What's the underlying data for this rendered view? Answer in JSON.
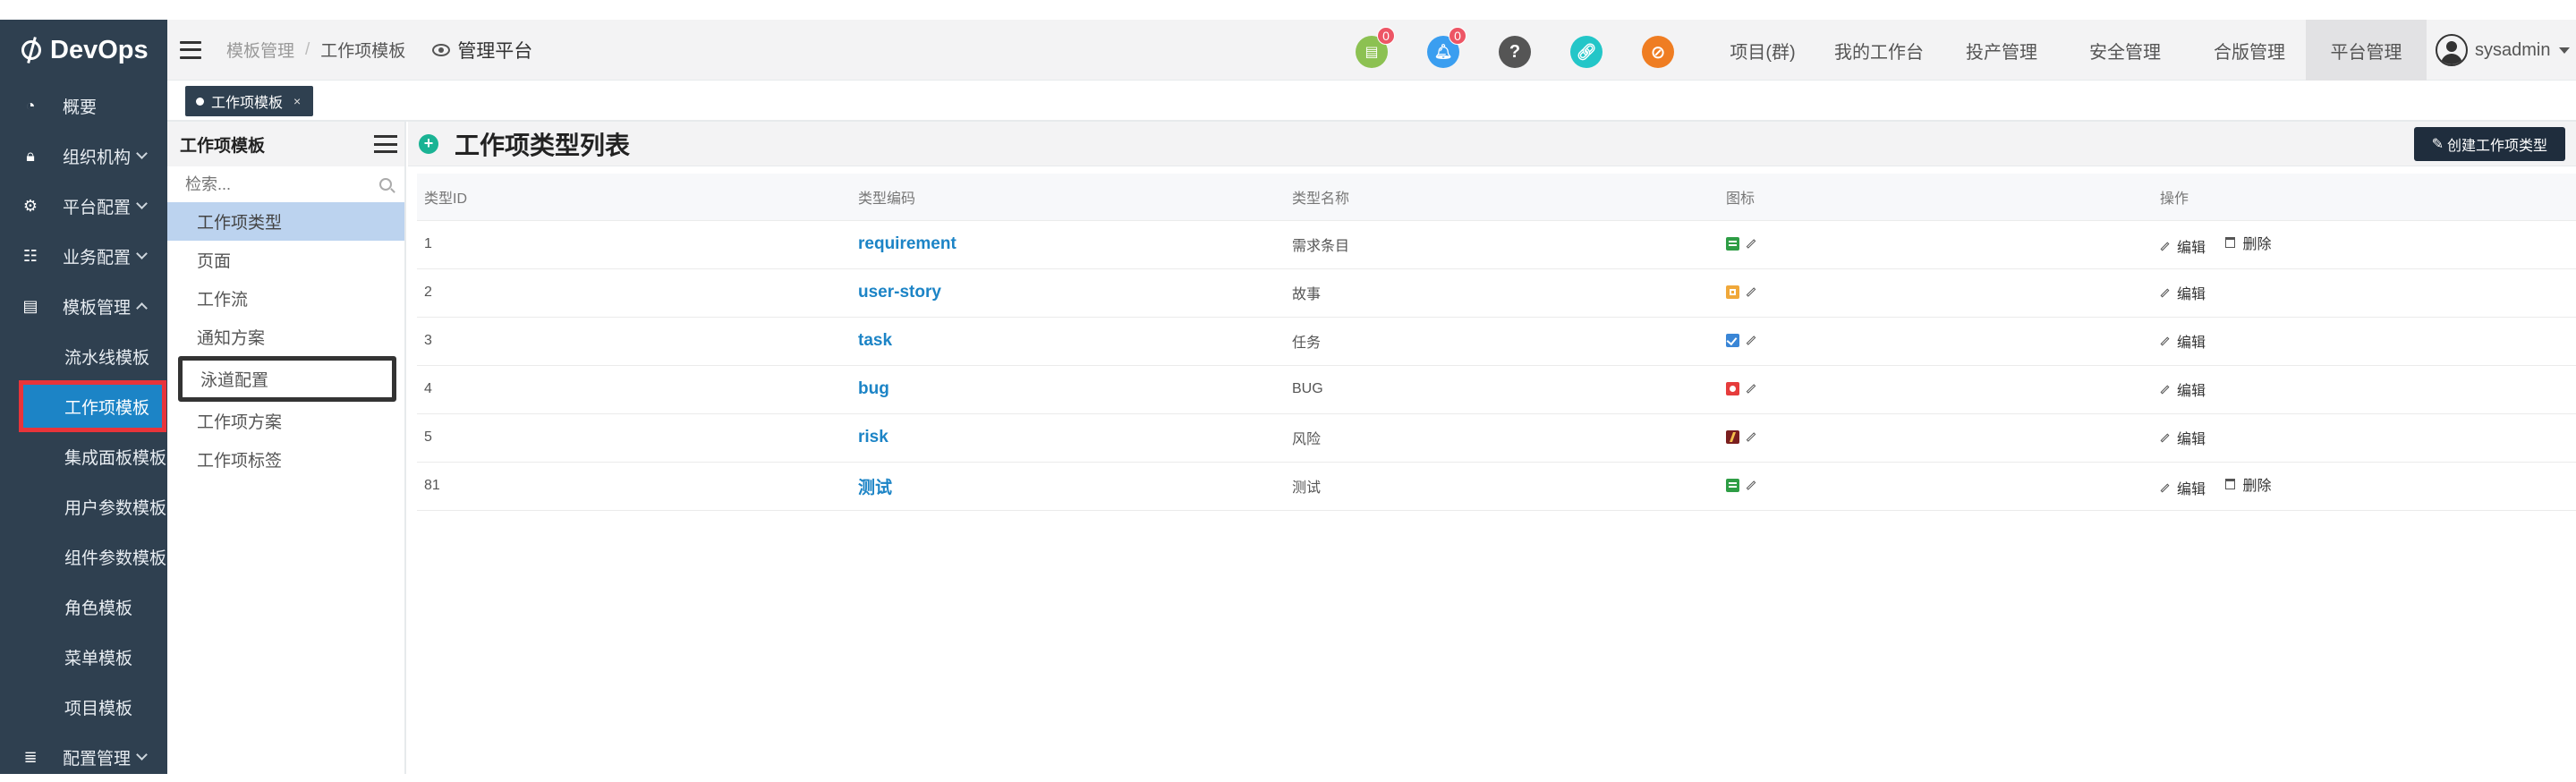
{
  "app": {
    "logo": "DevOps"
  },
  "sidebar": {
    "items": [
      {
        "label": "概要",
        "icon": "dashboard-icon"
      },
      {
        "label": "组织机构",
        "icon": "lock-icon"
      },
      {
        "label": "平台配置",
        "icon": "gear-icon"
      },
      {
        "label": "业务配置",
        "icon": "sliders-icon"
      },
      {
        "label": "模板管理",
        "icon": "template-icon"
      }
    ],
    "sub_items": [
      "流水线模板",
      "工作项模板",
      "集成面板模板",
      "用户参数模板",
      "组件参数模板",
      "角色模板",
      "菜单模板",
      "项目模板"
    ],
    "last_item": {
      "label": "配置管理",
      "icon": "database-icon"
    }
  },
  "header": {
    "breadcrumb": [
      "模板管理",
      "工作项模板"
    ],
    "separator": "/",
    "platform": "管理平台",
    "task_badge": "0",
    "bell_badge": "0",
    "help_glyph": "?",
    "nav": [
      "项目(群)",
      "我的工作台",
      "投产管理",
      "安全管理",
      "合版管理",
      "平台管理"
    ],
    "user": "sysadmin",
    "colors": {
      "task": "#8cc152",
      "bell": "#3a9ef0",
      "help": "#555555",
      "link": "#23c6c8",
      "block": "#ef7d22"
    }
  },
  "tabs": {
    "active": "工作项模板",
    "close": "×"
  },
  "template_menu": {
    "title": "工作项模板",
    "search_placeholder": "检索...",
    "items": [
      "工作项类型",
      "页面",
      "工作流",
      "通知方案",
      "泳道配置",
      "工作项方案",
      "工作项标签"
    ]
  },
  "main": {
    "title": "工作项类型列表",
    "create_button": "创建工作项类型",
    "columns": [
      "类型ID",
      "类型编码",
      "类型名称",
      "图标",
      "操作"
    ],
    "rows": [
      {
        "id": "1",
        "code": "requirement",
        "name": "需求条目",
        "icon": "green-list-icon",
        "actions": [
          "编辑",
          "删除"
        ]
      },
      {
        "id": "2",
        "code": "user-story",
        "name": "故事",
        "icon": "orange-story-icon",
        "actions": [
          "编辑"
        ]
      },
      {
        "id": "3",
        "code": "task",
        "name": "任务",
        "icon": "blue-check-icon",
        "actions": [
          "编辑"
        ]
      },
      {
        "id": "4",
        "code": "bug",
        "name": "BUG",
        "icon": "red-bug-icon",
        "actions": [
          "编辑"
        ]
      },
      {
        "id": "5",
        "code": "risk",
        "name": "风险",
        "icon": "lightning-icon",
        "actions": [
          "编辑"
        ]
      },
      {
        "id": "81",
        "code": "测试",
        "name": "测试",
        "icon": "green-list-icon",
        "actions": [
          "编辑",
          "删除"
        ]
      }
    ]
  }
}
